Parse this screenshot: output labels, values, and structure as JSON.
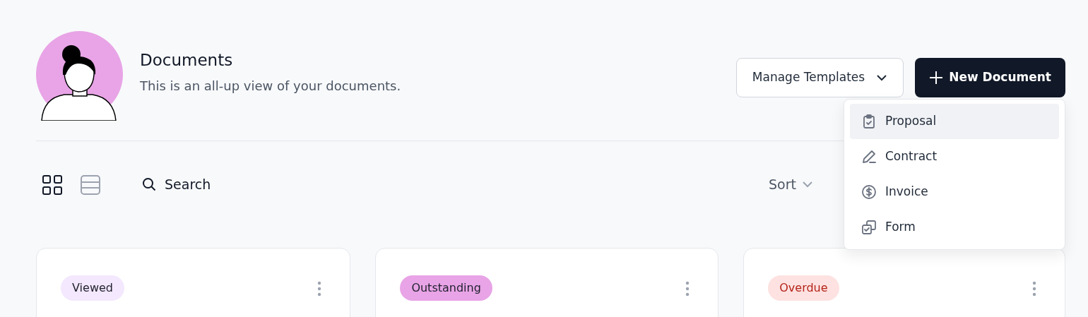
{
  "header": {
    "title": "Documents",
    "subtitle": "This is an all-up view of your documents."
  },
  "actions": {
    "manage_templates": "Manage Templates",
    "new_document": "New Document"
  },
  "menu": [
    {
      "label": "Proposal",
      "selected": true
    },
    {
      "label": "Contract",
      "selected": false
    },
    {
      "label": "Invoice",
      "selected": false
    },
    {
      "label": "Form",
      "selected": false
    }
  ],
  "toolbar": {
    "views": [
      {
        "kind": "grid",
        "selected": true
      },
      {
        "kind": "list",
        "selected": false
      }
    ],
    "search": "Search",
    "sort": "Sort"
  },
  "cards": [
    {
      "status": "Viewed",
      "color": "#f3e8fd",
      "kind": "neutral"
    },
    {
      "status": "Outstanding",
      "color": "#e8a4e6",
      "kind": "neutral"
    },
    {
      "status": "Overdue",
      "color": "#fde2e1",
      "kind": "alert"
    }
  ]
}
